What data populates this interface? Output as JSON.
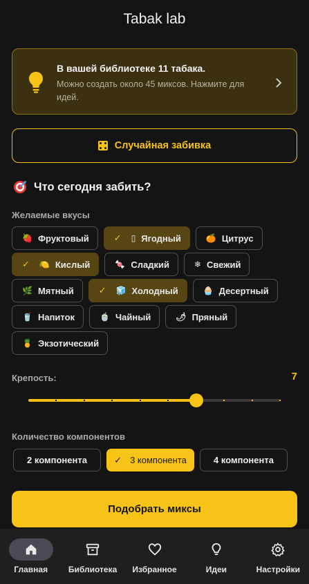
{
  "app": {
    "title": "Tabak lab"
  },
  "info_card": {
    "title": "В вашей библиотеке 11 табака.",
    "subtitle": "Можно создать около 45 миксов. Нажмите для идей."
  },
  "random_button": {
    "label": "Случайная забивка"
  },
  "section": {
    "title": "Что сегодня забить?"
  },
  "flavors": {
    "label": "Желаемые вкусы",
    "rows": [
      [
        {
          "emoji": "🍓",
          "label": "Фруктовый",
          "selected": false
        },
        {
          "emoji": "",
          "label": "Ягодный",
          "selected": true
        },
        {
          "emoji": "🍊",
          "label": "Цитрус",
          "selected": false
        }
      ],
      [
        {
          "emoji": "🍋",
          "label": "Кислый",
          "selected": true
        },
        {
          "emoji": "🍬",
          "label": "Сладкий",
          "selected": false
        },
        {
          "emoji": "❄",
          "label": "Свежий",
          "selected": false
        }
      ],
      [
        {
          "emoji": "🌿",
          "label": "Мятный",
          "selected": false
        },
        {
          "emoji": "🧊",
          "label": "Холодный",
          "selected": true
        },
        {
          "emoji": "🧁",
          "label": "Десертный",
          "selected": false
        }
      ],
      [
        {
          "emoji": "🥤",
          "label": "Напиток",
          "selected": false
        },
        {
          "emoji": "🍵",
          "label": "Чайный",
          "selected": false
        },
        {
          "emoji": "🌶",
          "label": "Пряный",
          "selected": false
        }
      ],
      [
        {
          "emoji": "🍍",
          "label": "Экзотический",
          "selected": false
        }
      ]
    ]
  },
  "strength": {
    "label": "Крепость:",
    "value": "7",
    "fraction": 0.6667
  },
  "components": {
    "label": "Количество компонентов",
    "options": [
      {
        "label": "2 компонента",
        "selected": false
      },
      {
        "label": "3 компонента",
        "selected": true
      },
      {
        "label": "4 компонента",
        "selected": false
      }
    ]
  },
  "cta": {
    "label": "Подобрать миксы"
  },
  "nav": [
    {
      "icon": "home-icon",
      "label": "Главная",
      "active": true
    },
    {
      "icon": "archive-icon",
      "label": "Библиотека",
      "active": false
    },
    {
      "icon": "heart-icon",
      "label": "Избранное",
      "active": false
    },
    {
      "icon": "lightbulb-icon",
      "label": "Идеи",
      "active": false
    },
    {
      "icon": "gear-icon",
      "label": "Настройки",
      "active": false
    }
  ],
  "colors": {
    "accent": "#f7c316",
    "background": "#141414",
    "selected_chip": "#574513"
  }
}
